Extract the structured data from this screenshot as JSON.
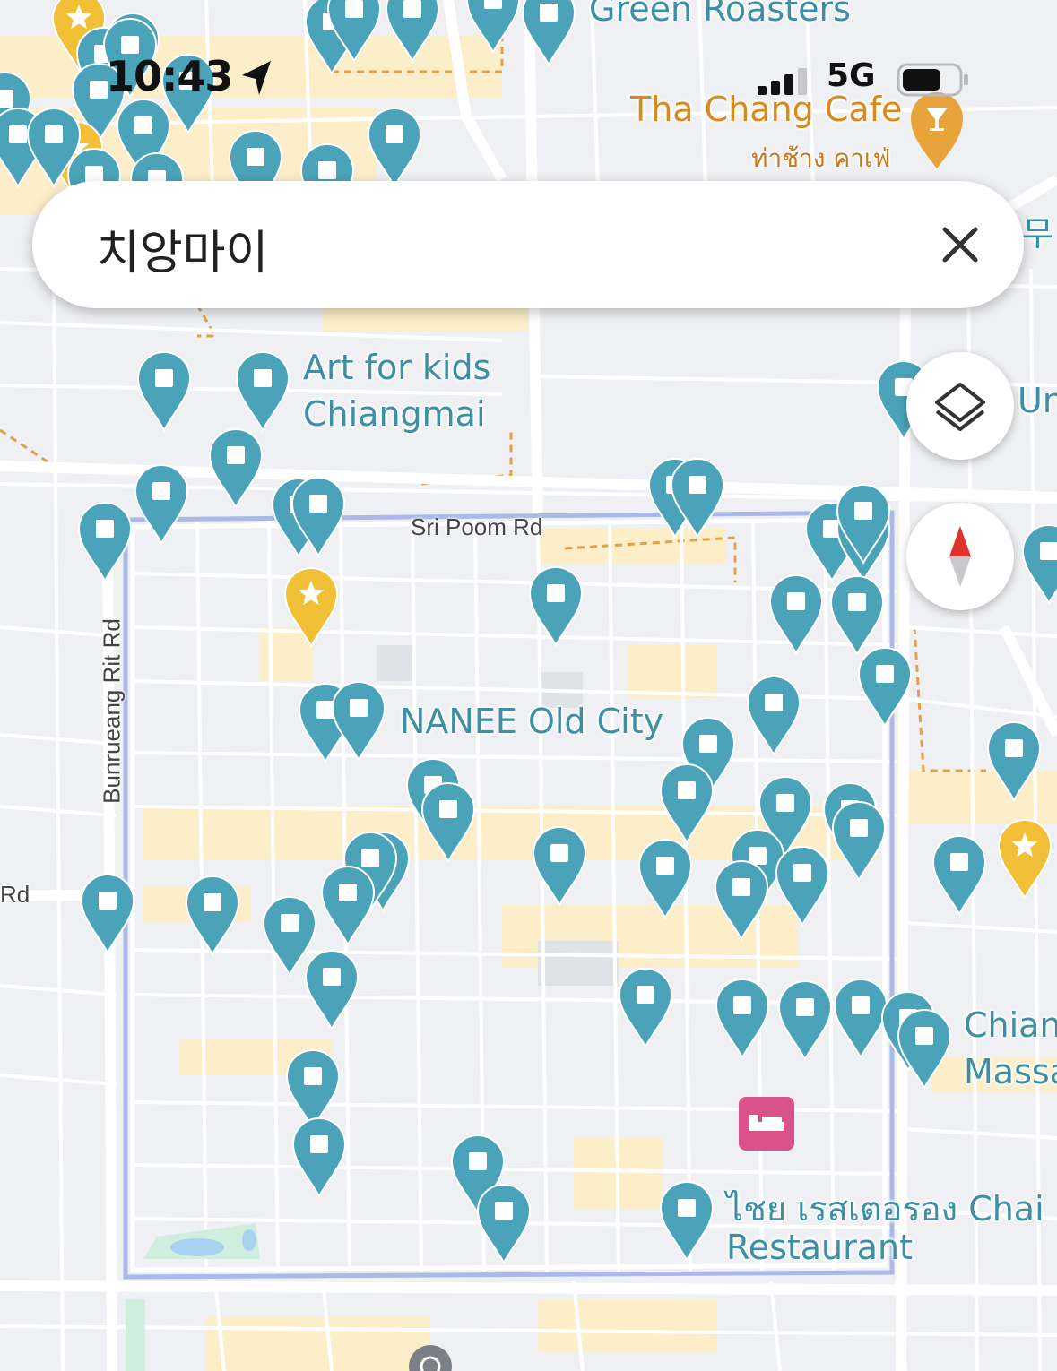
{
  "status_bar": {
    "time": "10:43",
    "network": "5G"
  },
  "search": {
    "query": "치앙마이"
  },
  "map": {
    "roads": {
      "sri_poom": "Sri Poom Rd",
      "bunrueang": "Bunrueang Rit Rd",
      "rd_fragment": "Rd"
    },
    "places": {
      "green_roasters": "Green Roasters",
      "tha_chang_cafe": "Tha Chang Cafe",
      "tha_chang_cafe_thai": "ท่าช้าง คาเฟ่",
      "art_for_kids_line1": "Art for kids",
      "art_for_kids_line2": "Chiangmai",
      "nanee": "NANEE Old City",
      "chai_line1": "ไชย เรสเตอรอง Chai",
      "chai_line2": "Restaurant",
      "chian_line1": "Chian",
      "chian_line2": "Massa",
      "un_fragment": "Un",
      "mu_fragment": "무"
    }
  },
  "controls": {
    "layers_icon": "layers-icon",
    "compass_icon": "compass-icon"
  },
  "colors": {
    "saved_pin": "#4aa3b8",
    "starred_pin": "#f2c037",
    "cafe": "#e8a33b",
    "hotel": "#d9538a",
    "old_city_wall": "#a9b9e8"
  }
}
